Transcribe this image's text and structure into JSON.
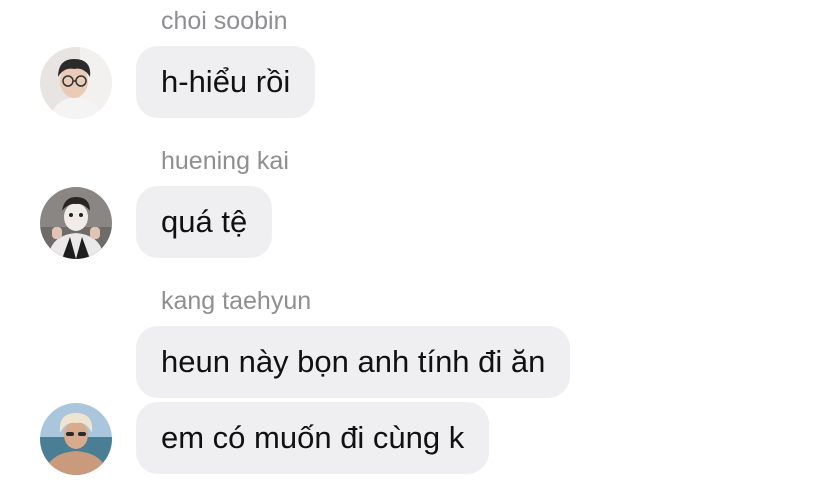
{
  "chat": {
    "messages": [
      {
        "sender": "choi soobin",
        "texts": [
          "h-hiểu rồi"
        ],
        "avatar_icon": "avatar-photo-icon"
      },
      {
        "sender": "huening kai",
        "texts": [
          "quá tệ"
        ],
        "avatar_icon": "avatar-photo-icon"
      },
      {
        "sender": "kang taehyun",
        "texts": [
          "heun này bọn anh tính đi ăn",
          "em có muốn đi cùng k"
        ],
        "avatar_icon": "avatar-photo-icon"
      }
    ]
  },
  "colors": {
    "background": "#ffffff",
    "bubble": "#efeff1",
    "sender_name": "#8e8e93",
    "message_text": "#111111"
  }
}
